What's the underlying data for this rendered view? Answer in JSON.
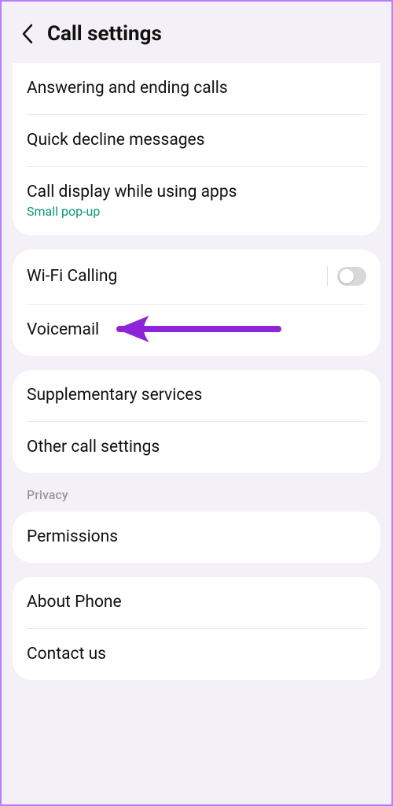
{
  "header": {
    "title": "Call settings"
  },
  "card1": {
    "answering": "Answering and ending calls",
    "quick_decline": "Quick decline messages",
    "call_display": "Call display while using apps",
    "call_display_sub": "Small pop-up"
  },
  "card2": {
    "wifi_calling": "Wi-Fi Calling",
    "voicemail": "Voicemail"
  },
  "card3": {
    "supplementary": "Supplementary services",
    "other": "Other call settings"
  },
  "section_privacy": "Privacy",
  "card4": {
    "permissions": "Permissions"
  },
  "card5": {
    "about": "About Phone",
    "contact": "Contact us"
  }
}
